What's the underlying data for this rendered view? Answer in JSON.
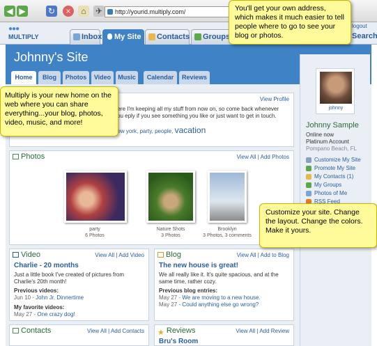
{
  "browser": {
    "url": "http://yourid.multiply.com/"
  },
  "app": {
    "logo": "MULTIPLY",
    "logout": "logout",
    "search": "Search",
    "nav": [
      {
        "label": "Inbox"
      },
      {
        "label": "My Site"
      },
      {
        "label": "Contacts"
      },
      {
        "label": "Groups"
      }
    ]
  },
  "site": {
    "title": "Johnny's Site",
    "tabs": [
      "Home",
      "Blog",
      "Photos",
      "Video",
      "Music",
      "Calendar",
      "Reviews"
    ]
  },
  "welcome": {
    "view_profile": "View Profile",
    "text": "here I'm keeping all my stuff from now on, so come back whenever you eply if you see something you like or just want to get in touch.",
    "tags": "new york, party, people,",
    "big_tag": "vacation"
  },
  "photos": {
    "title": "Photos",
    "view_all": "View All",
    "add": "Add Photos",
    "albums": [
      {
        "name": "party",
        "count": "6 Photos"
      },
      {
        "name": "Nature Shots",
        "count": "3 Photos"
      },
      {
        "name": "Brooklyn",
        "count": "3 Photos, 3 comments"
      }
    ]
  },
  "video": {
    "title": "Video",
    "view_all": "View All",
    "add": "Add Video",
    "item_title": "Charlie - 20 months",
    "item_text": "Just a little book I've created of pictures from Charlie's 20th month!",
    "prev_label": "Previous videos:",
    "prev_date": "Jun 10 -",
    "prev_link": "John Jr. Dinnertime",
    "fav_label": "My favorite videos:",
    "fav_date": "May 27 -",
    "fav_link": "One crazy dog!"
  },
  "blog": {
    "title": "Blog",
    "view_all": "View All",
    "add": "Add to Blog",
    "item_title": "The new house is great!",
    "item_text": "We all really like it. It's quite spacious, and at the same time, rather cozy.",
    "prev_label": "Previous blog entries:",
    "entries": [
      {
        "date": "May 27 -",
        "link": "We are moving to a new house."
      },
      {
        "date": "May 27 -",
        "link": "Could anything else go wrong?"
      }
    ]
  },
  "contacts": {
    "title": "Contacts",
    "view_all": "View All",
    "add": "Add Contacts"
  },
  "reviews": {
    "title": "Reviews",
    "view_all": "View All",
    "add": "Add Review",
    "item_title": "Bru's Room"
  },
  "profile": {
    "avatar_name": "johnny",
    "name": "Johnny Sample",
    "status": "Online now",
    "account": "Platinum Account",
    "location": "Pompano Beach, FL",
    "links": [
      "Customize My Site",
      "Promote My Site",
      "My Contacts (1)",
      "My Groups",
      "Photos of Me",
      "RSS Feed"
    ]
  },
  "callouts": {
    "address": "You'll get your own address, which makes it much easier to tell people where to go to see your blog or photos.",
    "home": "Multiply is your new home on the web where you can share everything...your blog, photos, video, music, and more!",
    "customize": "Customize your site. Change the layout. Change the colors. Make it yours."
  },
  "colors": {
    "accent": "#3f82c6",
    "callout": "#fffa9a",
    "heading_green": "#2a6a3a"
  }
}
